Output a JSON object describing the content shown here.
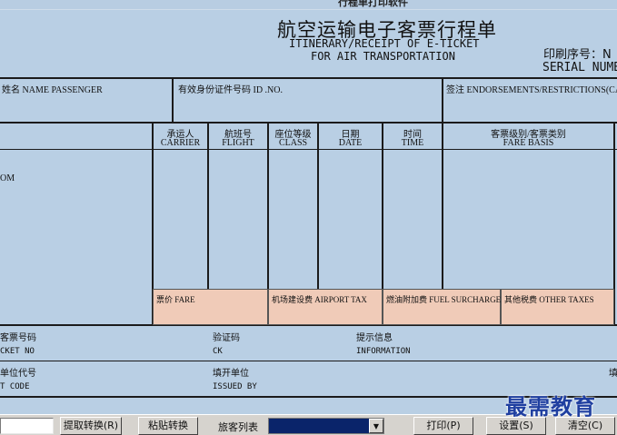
{
  "window": {
    "title": "行程单打印软件"
  },
  "ticket": {
    "title_cn": "航空运输电子客票行程单",
    "title_en1": "ITINERARY/RECEIPT OF E-TICKET",
    "title_en2": "FOR AIR TRANSPORTATION",
    "serial_cn": "印刷序号：N",
    "serial_en": "SERIAL NUMB",
    "passenger_label": "姓名 NAME PASSENGER",
    "id_label": "有效身份证件号码  ID .NO.",
    "endorse_label": "签注 ENDORSEMENTS/RESTRICTIONS(CA",
    "columns": [
      {
        "cn": "承运人",
        "en": "CARRIER"
      },
      {
        "cn": "航班号",
        "en": "FLIGHT"
      },
      {
        "cn": "座位等级",
        "en": "CLASS"
      },
      {
        "cn": "日期",
        "en": "DATE"
      },
      {
        "cn": "时间",
        "en": "TIME"
      },
      {
        "cn": "客票级别/客票类别",
        "en": "FARE BASIS"
      }
    ],
    "from_label": "OM",
    "fare": {
      "fare_label": "票价 FARE",
      "airport_tax_label": "机场建设费 AIRPORT TAX",
      "fuel_label": "燃油附加费 FUEL SURCHARGE",
      "other_tax_label": "其他税费 OTHER TAXES"
    },
    "ticket_no_cn": "客票号码",
    "ticket_no_en": "CKET NO",
    "check_cn": "验证码",
    "check_en": "CK",
    "info_cn": "提示信息",
    "info_en": "INFORMATION",
    "agent_cn": "单位代号",
    "agent_en": "T CODE",
    "issued_cn": "填开单位",
    "issued_en": "ISSUED BY",
    "edge_cn": "填"
  },
  "toolbar": {
    "extract_label": "提取转换(R)",
    "paste_label": "粘贴转换",
    "passenger_list_label": "旅客列表",
    "print_label": "打印(P)",
    "settings_label": "设置(S)",
    "clear_label": "清空(C)"
  },
  "watermark": "最需教育",
  "colors": {
    "ticket_bg": "#b9cfe4",
    "fare_cell_bg": "#f0cbb8",
    "toolbar_bg": "#d6d3ce",
    "select_bg": "#0a246a",
    "watermark": "#1f3fa0"
  }
}
